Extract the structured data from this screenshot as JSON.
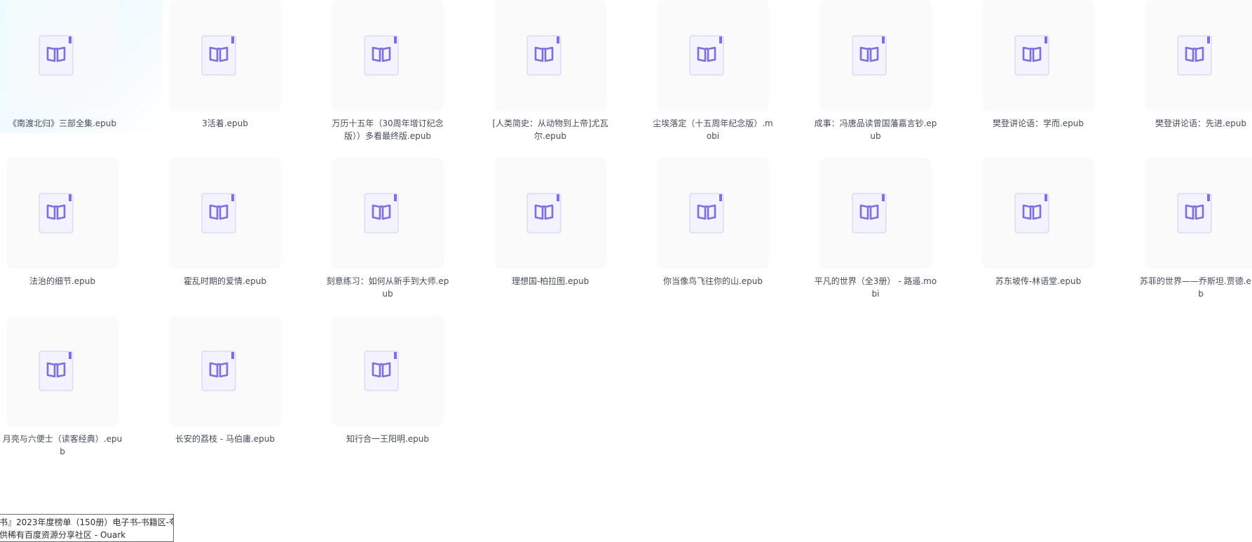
{
  "colors": {
    "icon_accent": "#7b6ee6",
    "icon_fill": "#f3f2ff",
    "thumb_bg": "#fafafb",
    "text": "#454d5a"
  },
  "file_icon": "ebook-book-icon",
  "files": [
    {
      "name": "《南渡北归》三部全集.epub"
    },
    {
      "name": "3活着.epub"
    },
    {
      "name": "万历十五年（30周年增订纪念版））多看最终版.epub"
    },
    {
      "name": "[人类简史：从动物到上帝]尤瓦尔.epub"
    },
    {
      "name": "尘埃落定（十五周年纪念版）.mobi"
    },
    {
      "name": "成事：冯唐品读曾国藩嘉言钞.epub"
    },
    {
      "name": "樊登讲论语：学而.epub"
    },
    {
      "name": "樊登讲论语：先进.epub"
    },
    {
      "name": "法治的细节.epub"
    },
    {
      "name": "霍乱时期的爱情.epub"
    },
    {
      "name": "刻意练习：如何从新手到大师.epub"
    },
    {
      "name": "理想国-柏拉图.epub"
    },
    {
      "name": "你当像鸟飞往你的山.epub"
    },
    {
      "name": "平凡的世界（全3册） - 路遥.mobi"
    },
    {
      "name": "苏东坡传-林语堂.epub"
    },
    {
      "name": "苏菲的世界——乔斯坦.贾德.epub"
    },
    {
      "name": "月亮与六便士（读客经典）.epub"
    },
    {
      "name": "长安的荔枝 - 马伯庸.epub"
    },
    {
      "name": "知行合一王阳明.epub"
    }
  ],
  "tooltip": {
    "line1": "书』2023年度榜单（150册）电子书-书籍区-夸",
    "line2": "供稀有百度资源分享社区 - Ouark"
  }
}
